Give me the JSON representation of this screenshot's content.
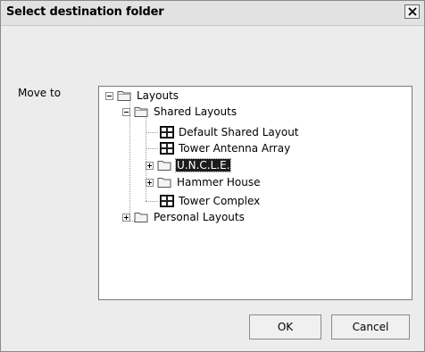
{
  "window": {
    "title": "Select destination folder"
  },
  "form": {
    "move_to_label": "Move to"
  },
  "tree": {
    "root": "Layouts",
    "shared": "Shared Layouts",
    "default_shared": "Default Shared Layout",
    "tower_antenna": "Tower Antenna Array",
    "uncle": "U.N.C.L.E.",
    "hammer_house": "Hammer House",
    "tower_complex": "Tower Complex",
    "personal": "Personal Layouts"
  },
  "buttons": {
    "ok": "OK",
    "cancel": "Cancel"
  }
}
